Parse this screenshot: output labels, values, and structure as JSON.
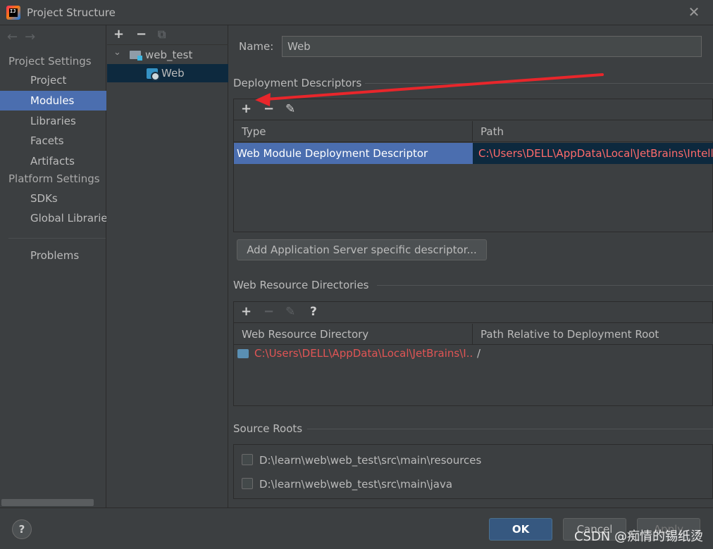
{
  "window": {
    "title": "Project Structure",
    "close_glyph": "✕"
  },
  "sidebar": {
    "nav_back": "←",
    "nav_forward": "→",
    "section_project": "Project Settings",
    "section_platform": "Platform Settings",
    "items": [
      {
        "label": "Project"
      },
      {
        "label": "Modules"
      },
      {
        "label": "Libraries"
      },
      {
        "label": "Facets"
      },
      {
        "label": "Artifacts"
      },
      {
        "label": "SDKs"
      },
      {
        "label": "Global Libraries"
      },
      {
        "label": "Problems"
      }
    ],
    "selected": "Modules"
  },
  "tree": {
    "add": "+",
    "remove": "−",
    "copy": "⧉",
    "root": {
      "label": "web_test",
      "expanded_glyph": "⌄"
    },
    "child": {
      "label": "Web"
    }
  },
  "main": {
    "name_label": "Name:",
    "name_value": "Web",
    "deployment": {
      "title": "Deployment Descriptors",
      "toolbar": {
        "add": "+",
        "remove": "−",
        "edit": "✎"
      },
      "columns": [
        "Type",
        "Path"
      ],
      "rows": [
        {
          "type": "Web Module Deployment Descriptor",
          "path": "C:\\Users\\DELL\\AppData\\Local\\JetBrains\\IntelliJ"
        }
      ],
      "add_server_button": "Add Application Server specific descriptor..."
    },
    "web_resources": {
      "title": "Web Resource Directories",
      "toolbar": {
        "add": "+",
        "remove": "−",
        "edit": "✎",
        "help": "?"
      },
      "columns": [
        "Web Resource Directory",
        "Path Relative to Deployment Root"
      ],
      "rows": [
        {
          "directory": "C:\\Users\\DELL\\AppData\\Local\\JetBrains\\I...",
          "relative": "/"
        }
      ]
    },
    "source_roots": {
      "title": "Source Roots",
      "items": [
        {
          "path": "D:\\learn\\web\\web_test\\src\\main\\resources",
          "checked": false
        },
        {
          "path": "D:\\learn\\web\\web_test\\src\\main\\java",
          "checked": false
        }
      ]
    }
  },
  "footer": {
    "help": "?",
    "ok": "OK",
    "cancel": "Cancel",
    "apply": "Apply",
    "watermark": "CSDN @痴情的锡纸烫"
  },
  "colors": {
    "accent_selection": "#4b6eaf",
    "error_path": "#e05555",
    "annotation_arrow": "#e8262b"
  }
}
